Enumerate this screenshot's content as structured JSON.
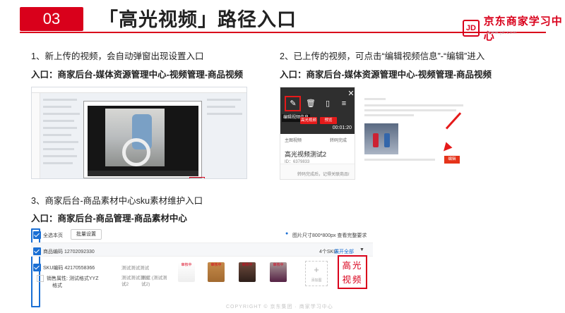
{
  "header": {
    "section_number": "03",
    "title": "「高光视频」路径入口",
    "logo_mark": "JD",
    "logo_text": "京东商家学习中心",
    "logo_url": "www.jd.com"
  },
  "sections": [
    {
      "heading": "1、新上传的视频，会自动弹窗出现设置入口",
      "path": "入口：商家后台-媒体资源管理中心-视频管理-商品视频"
    },
    {
      "heading": "2、已上传的视频，可点击“编辑视频信息”-“编辑”进入",
      "path": "入口：商家后台-媒体资源管理中心-视频管理-商品视频"
    },
    {
      "heading": "3、商家后台-商品素材中心sku素材维护入口",
      "path": "入口：商家后台-商品管理-商品素材中心"
    }
  ],
  "shot2": {
    "tooltip": "编辑视频信息",
    "time": "00:01:20",
    "btn_a": "高光视频",
    "btn_b": "预览",
    "tab_a": "主图视频",
    "tab_b": "转码完成",
    "video_name": "高光视频测试2",
    "video_id": "ID：6379833",
    "status_note": "转码完成后，记得关联商品!"
  },
  "shot3": {
    "edit_label": "编辑"
  },
  "table": {
    "select_page": "全选本页",
    "batch_btn": "批量设置",
    "image_note": "图片尺寸800*800px 查看完整要求",
    "product_code": "商品编码 12702092330",
    "sku_summary": "4个SKU",
    "expand_all": "展开全部",
    "sku_code": "SKU编码 42170558366",
    "sku_attr": "销售属性: 测试格式YYZ",
    "sku_attr2": "格式",
    "test_text1": "测试测试测试",
    "test_text2": "测试测试测试",
    "test_text2b": "试2",
    "test_text3": "测试 (测试测",
    "test_text3b": "试2)",
    "product_tag": "审核中",
    "add_label": "添加图",
    "highlight_label_1": "高光",
    "highlight_label_2": "视频"
  },
  "footer": "COPYRIGHT © 京东集团 · 商家学习中心",
  "colors": {
    "brand_red": "#d9001b",
    "checkbox_blue": "#1a6fd4"
  }
}
